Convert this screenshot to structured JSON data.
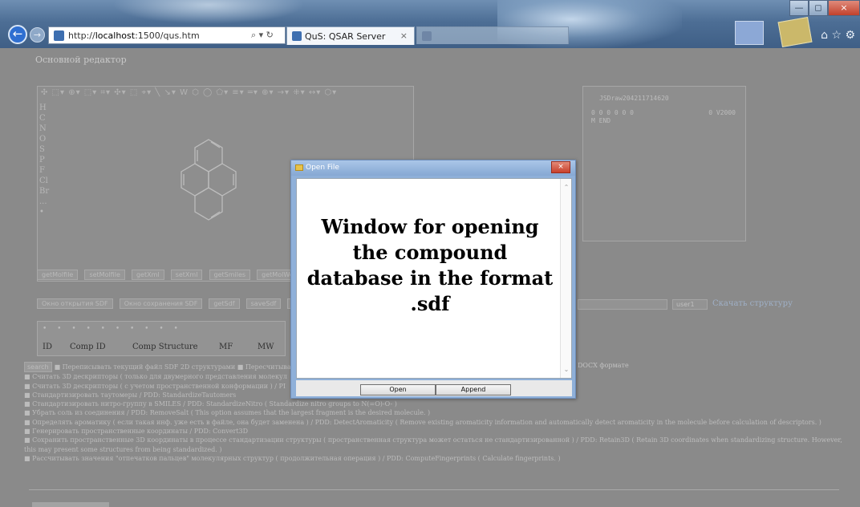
{
  "browser": {
    "url_prefix": "http://",
    "url_host": "localhost",
    "url_rest": ":1500/qus.htm",
    "address_controls": "⌕ ▾ ↻",
    "active_tab_title": "QuS: QSAR Server",
    "tab_close": "×",
    "back_glyph": "←",
    "forward_glyph": "→",
    "toolbar_icons": "⌂ ☆ ⚙",
    "window_min": "—",
    "window_max": "◻",
    "window_close": "×"
  },
  "page": {
    "title": "Основной редактор",
    "editor": {
      "toolbar_text": "✣ ⬚▾ ⊕▾ ⬚▾ ⌗▾ ✣▾ ⬚ ⌖▾ ╲ ↘▾ W ⬡ ◯ ⬠▾ ≡▾ ═▾ ⊕▾ →▾ ⁜▾ ↔▾ ⬡▾",
      "elements": [
        "H",
        "C",
        "N",
        "O",
        "S",
        "P",
        "F",
        "Cl",
        "Br",
        "...",
        "•"
      ]
    },
    "buttons_row1": [
      "getMolfile",
      "setMolfile",
      "getXml",
      "setXml",
      "getSmiles",
      "getMolWeight",
      "getEx"
    ],
    "buttons_row2": [
      "Окно открытия SDF",
      "Окно сохранения SDF",
      "getSdf",
      "saveSdf",
      "showSdf",
      ""
    ],
    "right_box": {
      "line1": "JSDraw204211714620",
      "line2": "  0  0  0  0  0  0",
      "line2b": "0 V2000",
      "line3": "M  END"
    },
    "user_field_value": "user1",
    "download_link": "Скачать структуру",
    "table": {
      "dots": "• • • • • • • • • •",
      "headers": [
        "ID",
        "Comp ID",
        "Comp Structure",
        "MF",
        "MW"
      ]
    },
    "options": [
      "■ Переписывать текущий файл SDF 2D структурами  ■ Пересчитывать",
      "■ Считать 3D дескрипторы ( только для двумерного представления молекул",
      "■ Считать 3D дескрипторы ( с учетом пространственной конформации ) / PI",
      "■ Стандартизировать таутомеры / PDD: StandardizeTautomers",
      "■ Стандартизировать нитро-группу в SMILES / PDD: StandardizeNitro ( Standardize nitro groups to N(=O)-O- )",
      "■ Убрать соль из соединения / PDD: RemoveSalt ( This option assumes that the largest fragment is the desired molecule. )",
      "■ Определять ароматику ( если такая инф. уже есть в файле, она будет заменена ) / PDD: DetectAromaticity ( Remove existing aromaticity information and automatically detect aromaticity in the molecule before calculation of descriptors. )",
      "■ Генерировать пространственные координаты / PDD: Convert3D",
      "■ Сохранить пространственные 3D координаты в процессе стандартизации структуры ( пространственная структура может остаться не стандартизированной ) / PDD: Retain3D ( Retain 3D coordinates when standardizing structure. However, this may present some structures from being standardized. )",
      "■ Рассчитывать значения \"отпечатков пальцев\" молекулярных структур ( продолжительная операция ) / PDD: ComputeFingerprints ( Calculate fingerprints. )"
    ],
    "search_button": "search",
    "docx_text": "DOCX формате"
  },
  "dialog": {
    "title": "Open File",
    "close": "×",
    "message": "Window for opening the compound database in the format .sdf",
    "scroll_up": "⌃",
    "scroll_down": "⌄",
    "open_button": "Open",
    "append_button": "Append"
  }
}
